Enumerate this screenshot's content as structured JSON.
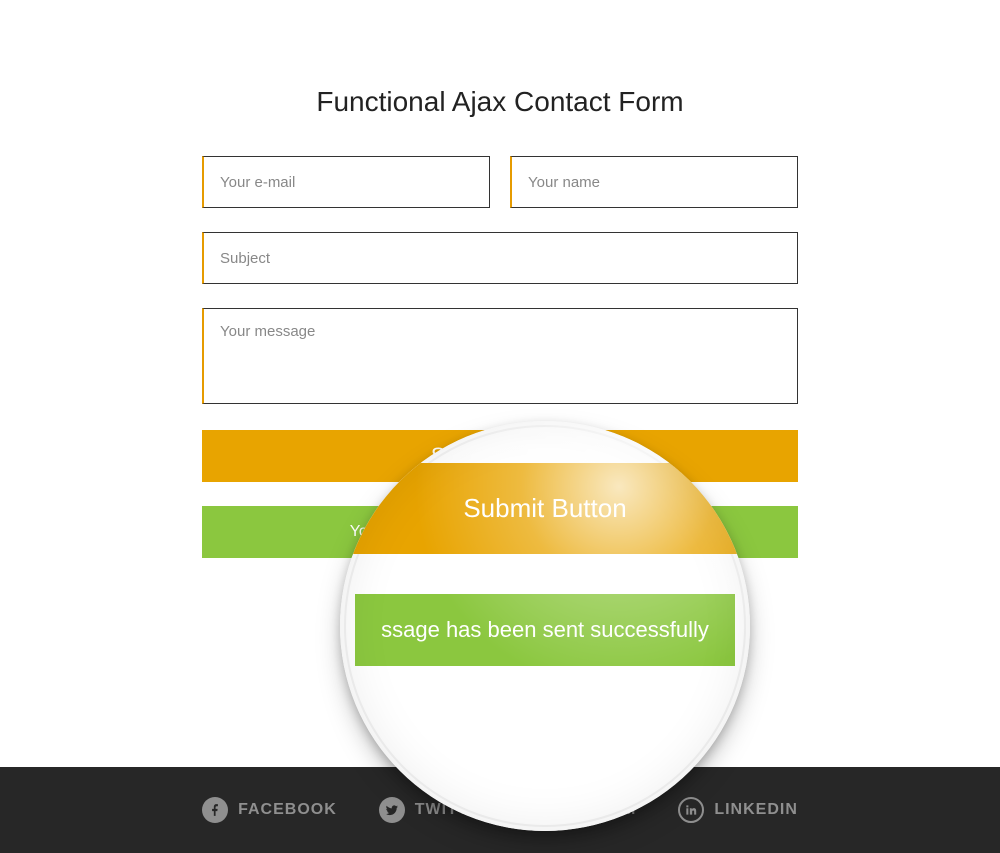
{
  "title": "Functional Ajax Contact Form",
  "form": {
    "email_placeholder": "Your e-mail",
    "name_placeholder": "Your name",
    "subject_placeholder": "Subject",
    "message_placeholder": "Your message",
    "submit_label": "Submit Button",
    "success_message": "Your message has been sent successfully.",
    "success_message_clipped": "ssage has been sent successfully"
  },
  "footer": {
    "facebook": "FACEBOOK",
    "twitter": "TWITTER",
    "instagram": "AGRAM",
    "linkedin": "LINKEDIN"
  },
  "colors": {
    "accent": "#e8a400",
    "success": "#8bc73f",
    "footer_bg": "#272727",
    "muted": "#8f8f8f"
  }
}
